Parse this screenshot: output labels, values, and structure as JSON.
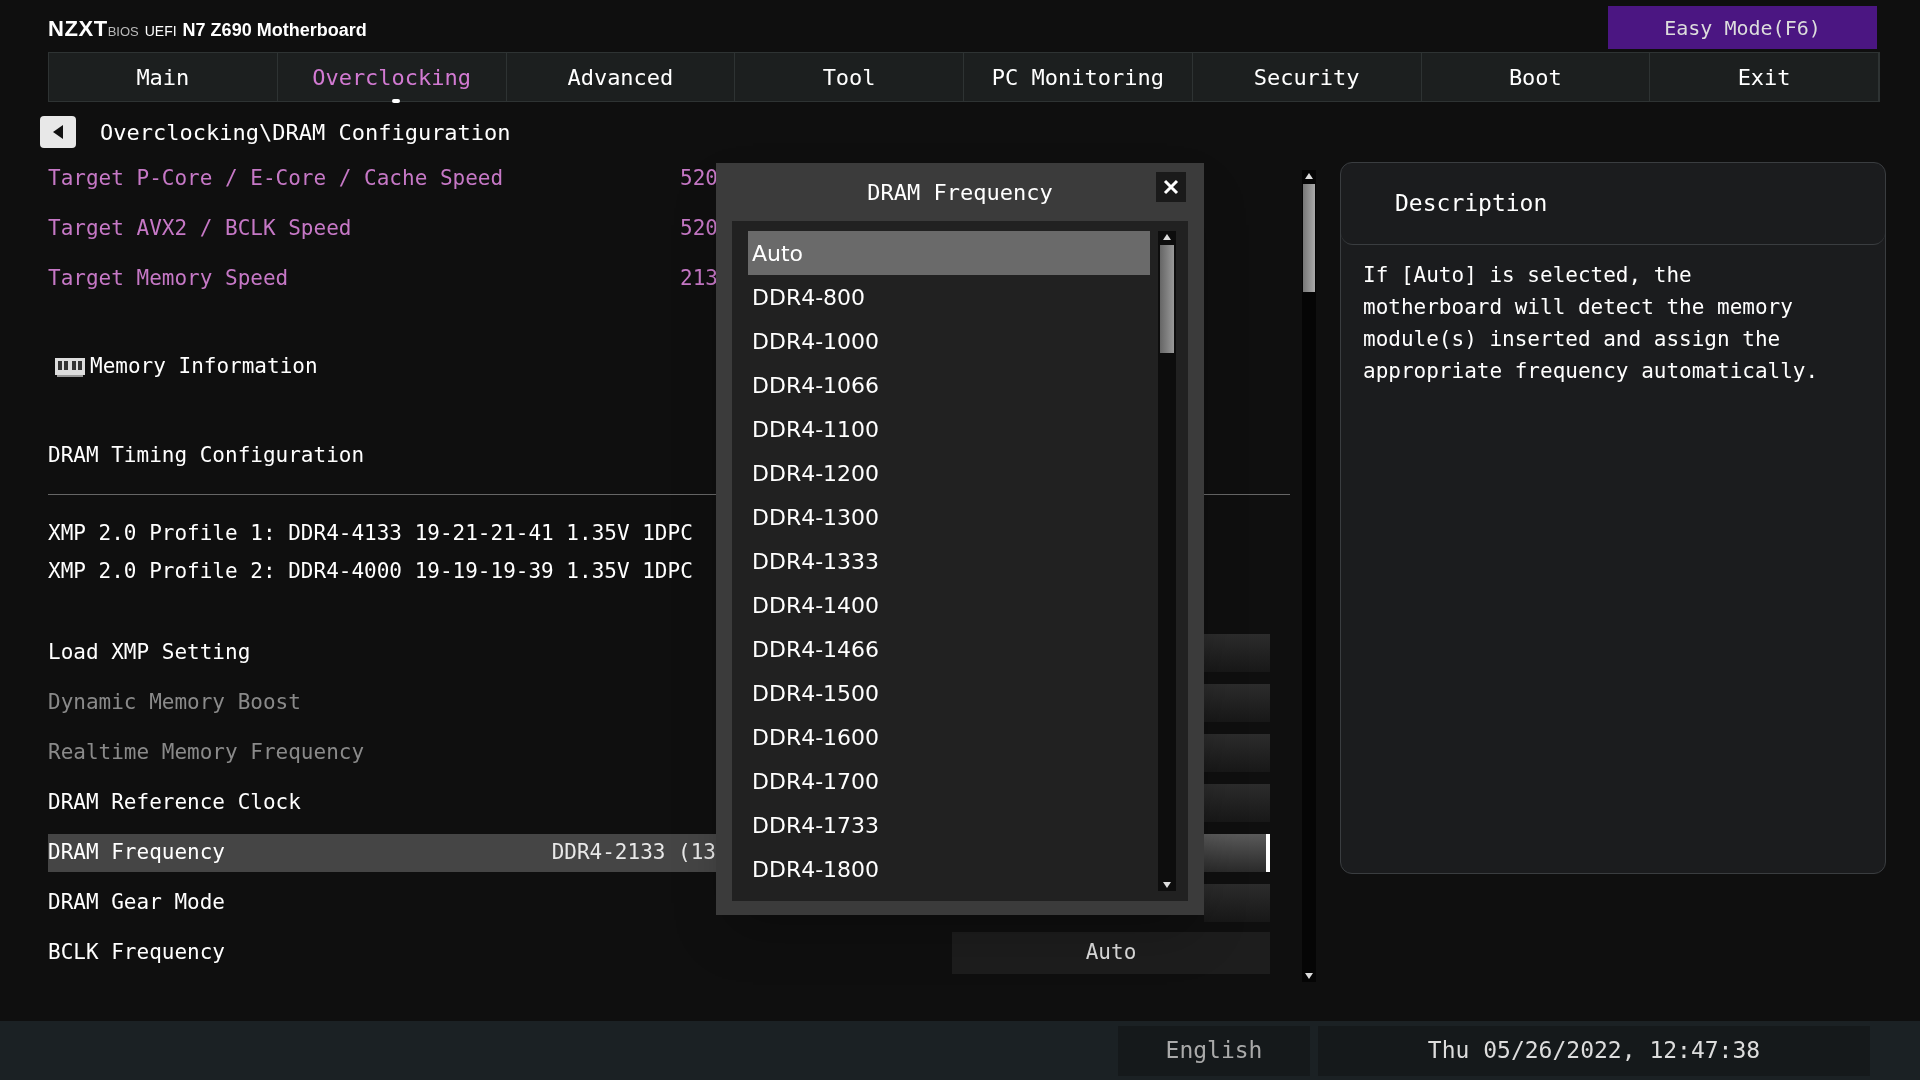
{
  "header": {
    "brand": "NZXT",
    "bios": "BIOS",
    "uefi": "UEFI",
    "model": "N7 Z690 Motherboard",
    "easy_mode": "Easy Mode(F6)"
  },
  "tabs": [
    {
      "label": "Main",
      "selected": false
    },
    {
      "label": "Overclocking",
      "selected": true
    },
    {
      "label": "Advanced",
      "selected": false
    },
    {
      "label": "Tool",
      "selected": false
    },
    {
      "label": "PC Monitoring",
      "selected": false
    },
    {
      "label": "Security",
      "selected": false
    },
    {
      "label": "Boot",
      "selected": false
    },
    {
      "label": "Exit",
      "selected": false
    }
  ],
  "breadcrumb": "Overclocking\\DRAM Configuration",
  "items": [
    {
      "kind": "info",
      "label": "Target P-Core / E-Core / Cache Speed",
      "value": "520"
    },
    {
      "kind": "info",
      "label": "Target AVX2 / BCLK Speed",
      "value": "520"
    },
    {
      "kind": "info",
      "label": "Target Memory Speed",
      "value": "213"
    },
    {
      "kind": "section",
      "label": "Memory Information"
    },
    {
      "kind": "heading",
      "label": "DRAM Timing Configuration"
    },
    {
      "kind": "text",
      "label": "XMP 2.0 Profile 1: DDR4-4133 19-21-21-41 1.35V 1DPC"
    },
    {
      "kind": "text",
      "label": "XMP 2.0 Profile 2: DDR4-4000 19-19-19-39 1.35V 1DPC"
    },
    {
      "kind": "setting",
      "label": "Load XMP Setting",
      "disabled": false,
      "selected": false
    },
    {
      "kind": "setting",
      "label": "Dynamic Memory Boost",
      "disabled": true,
      "selected": false
    },
    {
      "kind": "setting",
      "label": "Realtime Memory Frequency",
      "disabled": true,
      "selected": false
    },
    {
      "kind": "setting",
      "label": "DRAM Reference Clock",
      "disabled": false,
      "selected": false
    },
    {
      "kind": "setting",
      "label": "DRAM Frequency",
      "value": "DDR4-2133 (13",
      "disabled": false,
      "selected": true
    },
    {
      "kind": "setting",
      "label": "DRAM Gear Mode",
      "disabled": false,
      "selected": false
    },
    {
      "kind": "setting",
      "label": "BCLK Frequency",
      "control": "Auto",
      "disabled": false,
      "selected": false
    }
  ],
  "dialog": {
    "title": "DRAM Frequency",
    "options": [
      {
        "label": "Auto",
        "selected": true
      },
      {
        "label": "DDR4-800",
        "selected": false
      },
      {
        "label": "DDR4-1000",
        "selected": false
      },
      {
        "label": "DDR4-1066",
        "selected": false
      },
      {
        "label": "DDR4-1100",
        "selected": false
      },
      {
        "label": "DDR4-1200",
        "selected": false
      },
      {
        "label": "DDR4-1300",
        "selected": false
      },
      {
        "label": "DDR4-1333",
        "selected": false
      },
      {
        "label": "DDR4-1400",
        "selected": false
      },
      {
        "label": "DDR4-1466",
        "selected": false
      },
      {
        "label": "DDR4-1500",
        "selected": false
      },
      {
        "label": "DDR4-1600",
        "selected": false
      },
      {
        "label": "DDR4-1700",
        "selected": false
      },
      {
        "label": "DDR4-1733",
        "selected": false
      },
      {
        "label": "DDR4-1800",
        "selected": false
      }
    ]
  },
  "description": {
    "title": "Description",
    "text": "If [Auto] is selected, the motherboard will detect the memory module(s) inserted and assign the appropriate frequency automatically."
  },
  "status_bar": {
    "language": "English",
    "datetime": "Thu 05/26/2022, 12:47:38"
  }
}
